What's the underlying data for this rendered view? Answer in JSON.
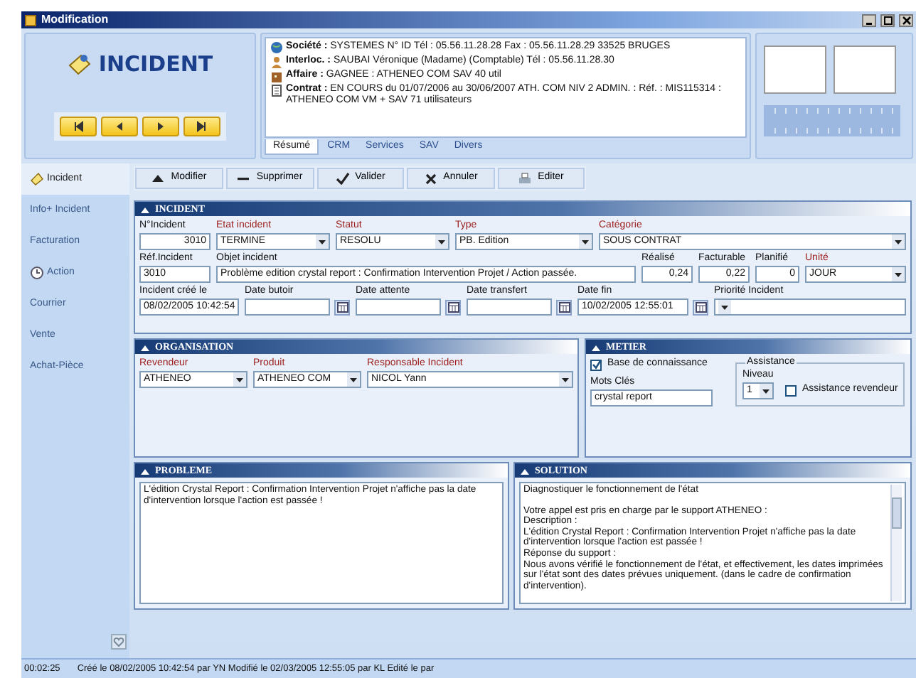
{
  "window": {
    "title": "Modification"
  },
  "header": {
    "title": "INCIDENT",
    "info_lines": [
      {
        "text": "**Société :**   SYSTEMES  N° ID  Tél : 05.56.11.28.28  Fax : 05.56.11.28.29  33525  BRUGES"
      },
      {
        "text": "**Interloc. :**  SAUBAI      Véronique (Madame) (Comptable)  Tél : 05.56.11.28.30"
      },
      {
        "text": "**Affaire :**  GAGNEE  : ATHENEO COM SAV 40 util"
      },
      {
        "text": "**Contrat :**  EN COURS du 01/07/2006 au 30/06/2007 ATH. COM NIV 2 ADMIN.  : Réf. : MIS115314  : ATHENEO COM VM + SAV 71 utilisateurs"
      }
    ],
    "info_tabs": [
      {
        "label": "Résumé",
        "selected": true
      },
      {
        "label": "CRM",
        "selected": false
      },
      {
        "label": "Services",
        "selected": false
      },
      {
        "label": "SAV",
        "selected": false
      },
      {
        "label": "Divers",
        "selected": false
      }
    ]
  },
  "sidebar": {
    "items": [
      {
        "label": "Incident",
        "selected": true
      },
      {
        "label": "Info+ Incident",
        "selected": false
      },
      {
        "label": "Facturation",
        "selected": false
      },
      {
        "label": "Action",
        "selected": false
      },
      {
        "label": "Courrier",
        "selected": false
      },
      {
        "label": "Vente",
        "selected": false
      },
      {
        "label": "Achat-Pièce",
        "selected": false
      }
    ]
  },
  "toolbar": [
    {
      "label": "Modifier"
    },
    {
      "label": "Supprimer"
    },
    {
      "label": "Valider"
    },
    {
      "label": "Annuler"
    },
    {
      "label": "Editer"
    }
  ],
  "incident": {
    "title": "INCIDENT",
    "field_lines": [
      {
        "fields": [
          {
            "label": "N°Incident",
            "kind": "number",
            "value": "3010",
            "required": false
          },
          {
            "label": "Etat incident",
            "kind": "select",
            "value": "TERMINE",
            "required": true
          },
          {
            "label": "Statut",
            "kind": "select",
            "value": "RESOLU",
            "required": true
          },
          {
            "label": "Type",
            "kind": "select",
            "value": "PB. Edition",
            "required": true
          },
          {
            "label": "Catégorie",
            "kind": "select",
            "value": "SOUS CONTRAT",
            "required": true
          }
        ]
      },
      {
        "fields": [
          {
            "label": "Réf.Incident",
            "kind": "text",
            "value": "3010",
            "required": false
          },
          {
            "label": "Objet incident",
            "kind": "text",
            "value": "Problème edition crystal report : Confirmation Intervention Projet / Action passée.",
            "required": false
          },
          {
            "label": "Réalisé",
            "kind": "number",
            "value": "0,24",
            "required": false
          },
          {
            "label": "Facturable",
            "kind": "number",
            "value": "0,22",
            "required": false
          },
          {
            "label": "Planifié",
            "kind": "number",
            "value": "0",
            "required": false
          },
          {
            "label": "Unité",
            "kind": "select",
            "value": "JOUR",
            "required": true
          }
        ]
      },
      {
        "fields": [
          {
            "label": "Incident créé le",
            "kind": "text",
            "value": "08/02/2005 10:42:54",
            "required": false
          },
          {
            "label": "Date butoir",
            "kind": "date",
            "required": false
          },
          {
            "label": "Date attente",
            "kind": "date",
            "required": false
          },
          {
            "label": "Date transfert",
            "kind": "date",
            "required": false
          },
          {
            "label": "Date fin",
            "kind": "date",
            "value": "10/02/2005 12:55:01",
            "required": false
          },
          {
            "label": "Priorité Incident",
            "kind": "select",
            "required": false
          }
        ]
      }
    ]
  },
  "organisation": {
    "title": "ORGANISATION",
    "fields": [
      {
        "label": "Revendeur",
        "kind": "select",
        "value": "ATHENEO",
        "required": true
      },
      {
        "label": "Produit",
        "kind": "select",
        "value": "ATHENEO COM",
        "required": true
      },
      {
        "label": "Responsable Incident",
        "kind": "select",
        "value": "NICOL Yann",
        "required": true
      }
    ]
  },
  "metier": {
    "title": "METIER",
    "knowledge_base": {
      "label": "Base de connaissance",
      "checked": true
    },
    "keywords": {
      "label": "Mots Clés",
      "value": "crystal report"
    },
    "assistance": {
      "title": "Assistance",
      "level": {
        "label": "Niveau",
        "value": "1"
      },
      "reseller": {
        "label": "Assistance revendeur",
        "checked": false
      }
    }
  },
  "probleme": {
    "title": "PROBLEME",
    "paragraphs": [
      [
        "L'édition Crystal Report : Confirmation Intervention Projet n'affiche pas la date d'intervention lorsque l'action est passée !"
      ]
    ]
  },
  "solution": {
    "title": "SOLUTION",
    "paragraphs": [
      [
        "Diagnostiquer le fonctionnement de l'état"
      ],
      [
        "Votre appel est pris en charge par le support ATHENEO :",
        "Description :",
        "L'édition Crystal Report : Confirmation Intervention Projet n'affiche pas la date d'intervention lorsque l'action est passée !",
        "Réponse du support :",
        "Nous avons vérifié le fonctionnement de l'état, et effectivement, les dates imprimées sur l'état sont des dates prévues uniquement. (dans le cadre de confirmation d'intervention)."
      ]
    ]
  },
  "status_bar": {
    "time": "00:02:25",
    "message": "Créé le 08/02/2005 10:42:54 par YN Modifié le 02/03/2005 12:55:05 par KL Edité le  par"
  }
}
